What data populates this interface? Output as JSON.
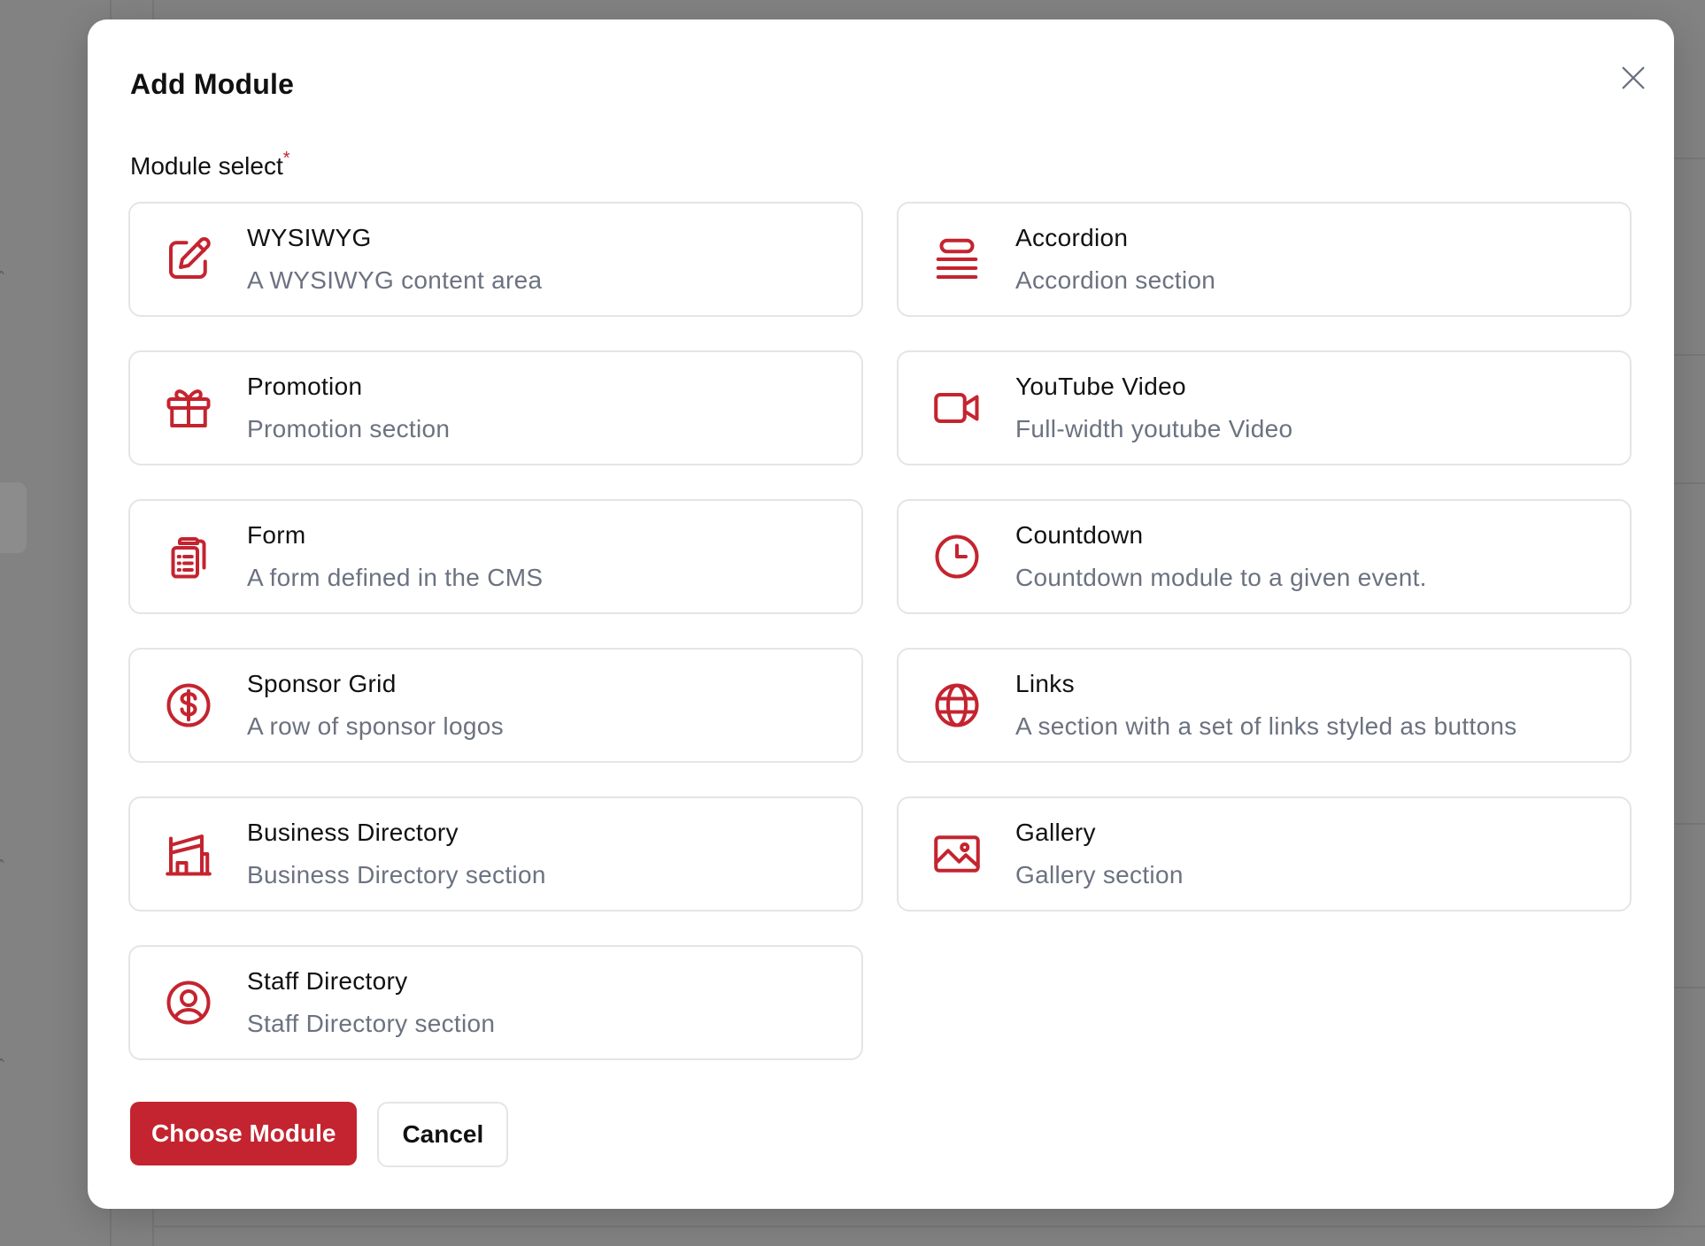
{
  "modal": {
    "title": "Add Module",
    "field_label": "Module select",
    "required_mark": "*",
    "accent_color": "#c4242f",
    "close_icon": "close-icon"
  },
  "modules": [
    {
      "title": "WYSIWYG",
      "description": "A WYSIWYG content area",
      "icon": "pencil-square-icon"
    },
    {
      "title": "Accordion",
      "description": "Accordion section",
      "icon": "stacked-lines-icon"
    },
    {
      "title": "Promotion",
      "description": "Promotion section",
      "icon": "gift-icon"
    },
    {
      "title": "YouTube Video",
      "description": "Full-width youtube Video",
      "icon": "video-camera-icon"
    },
    {
      "title": "Form",
      "description": "A form defined in the CMS",
      "icon": "clipboard-list-icon"
    },
    {
      "title": "Countdown",
      "description": "Countdown module to a given event.",
      "icon": "clock-icon"
    },
    {
      "title": "Sponsor Grid",
      "description": "A row of sponsor logos",
      "icon": "dollar-circle-icon"
    },
    {
      "title": "Links",
      "description": "A section with a set of links styled as buttons",
      "icon": "globe-icon"
    },
    {
      "title": "Business Directory",
      "description": "Business Directory section",
      "icon": "building-storefront-icon"
    },
    {
      "title": "Gallery",
      "description": "Gallery section",
      "icon": "photo-icon"
    },
    {
      "title": "Staff Directory",
      "description": "Staff Directory section",
      "icon": "user-circle-icon"
    }
  ],
  "footer": {
    "primary_label": "Choose Module",
    "secondary_label": "Cancel"
  }
}
